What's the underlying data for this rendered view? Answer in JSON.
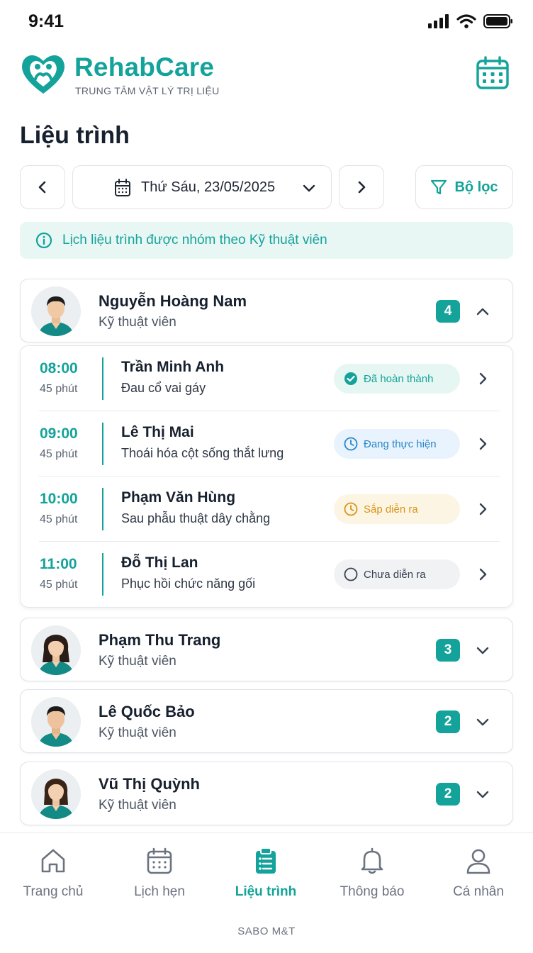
{
  "status_bar": {
    "time": "9:41"
  },
  "brand": {
    "name": "RehabCare",
    "subtitle": "TRUNG TÂM VẬT LÝ TRỊ LIỆU"
  },
  "page": {
    "title": "Liệu trình"
  },
  "toolbar": {
    "date_label": "Thứ Sáu, 23/05/2025",
    "filter_label": "Bộ lọc"
  },
  "info": {
    "text": "Lịch liệu trình được nhóm theo Kỹ thuật viên"
  },
  "groups": [
    {
      "name": "Nguyễn Hoàng Nam",
      "role": "Kỹ thuật viên",
      "count": "4",
      "expanded": true
    },
    {
      "name": "Phạm Thu Trang",
      "role": "Kỹ thuật viên",
      "count": "3",
      "expanded": false
    },
    {
      "name": "Lê Quốc Bảo",
      "role": "Kỹ thuật viên",
      "count": "2",
      "expanded": false
    },
    {
      "name": "Vũ Thị Quỳnh",
      "role": "Kỹ thuật viên",
      "count": "2",
      "expanded": false
    }
  ],
  "sessions": [
    {
      "time": "08:00",
      "duration": "45 phút",
      "patient": "Trần Minh Anh",
      "condition": "Đau cổ vai gáy",
      "status": "Đã hoàn thành",
      "status_color": "#14a39a"
    },
    {
      "time": "09:00",
      "duration": "45 phút",
      "patient": "Lê Thị Mai",
      "condition": "Thoái hóa cột sống thắt lưng",
      "status": "Đang thực hiện",
      "status_color": "#2a86c9"
    },
    {
      "time": "10:00",
      "duration": "45 phút",
      "patient": "Phạm Văn Hùng",
      "condition": "Sau phẫu thuật dây chằng",
      "status": "Sắp diễn ra",
      "status_color": "#d99417"
    },
    {
      "time": "11:00",
      "duration": "45 phút",
      "patient": "Đỗ Thị Lan",
      "condition": "Phục hồi chức năng gối",
      "status": "Chưa diễn ra",
      "status_color": "#374151"
    }
  ],
  "nav": [
    {
      "label": "Trang chủ",
      "icon": "home-icon",
      "active": false
    },
    {
      "label": "Lịch hẹn",
      "icon": "calendar-icon",
      "active": false
    },
    {
      "label": "Liệu trình",
      "icon": "clipboard-icon",
      "active": true
    },
    {
      "label": "Thông báo",
      "icon": "bell-icon",
      "active": false
    },
    {
      "label": "Cá nhân",
      "icon": "user-icon",
      "active": false
    }
  ],
  "footer": {
    "brand": "SABO M&T"
  },
  "colors": {
    "accent": "#14a39a",
    "text": "#17202e"
  }
}
